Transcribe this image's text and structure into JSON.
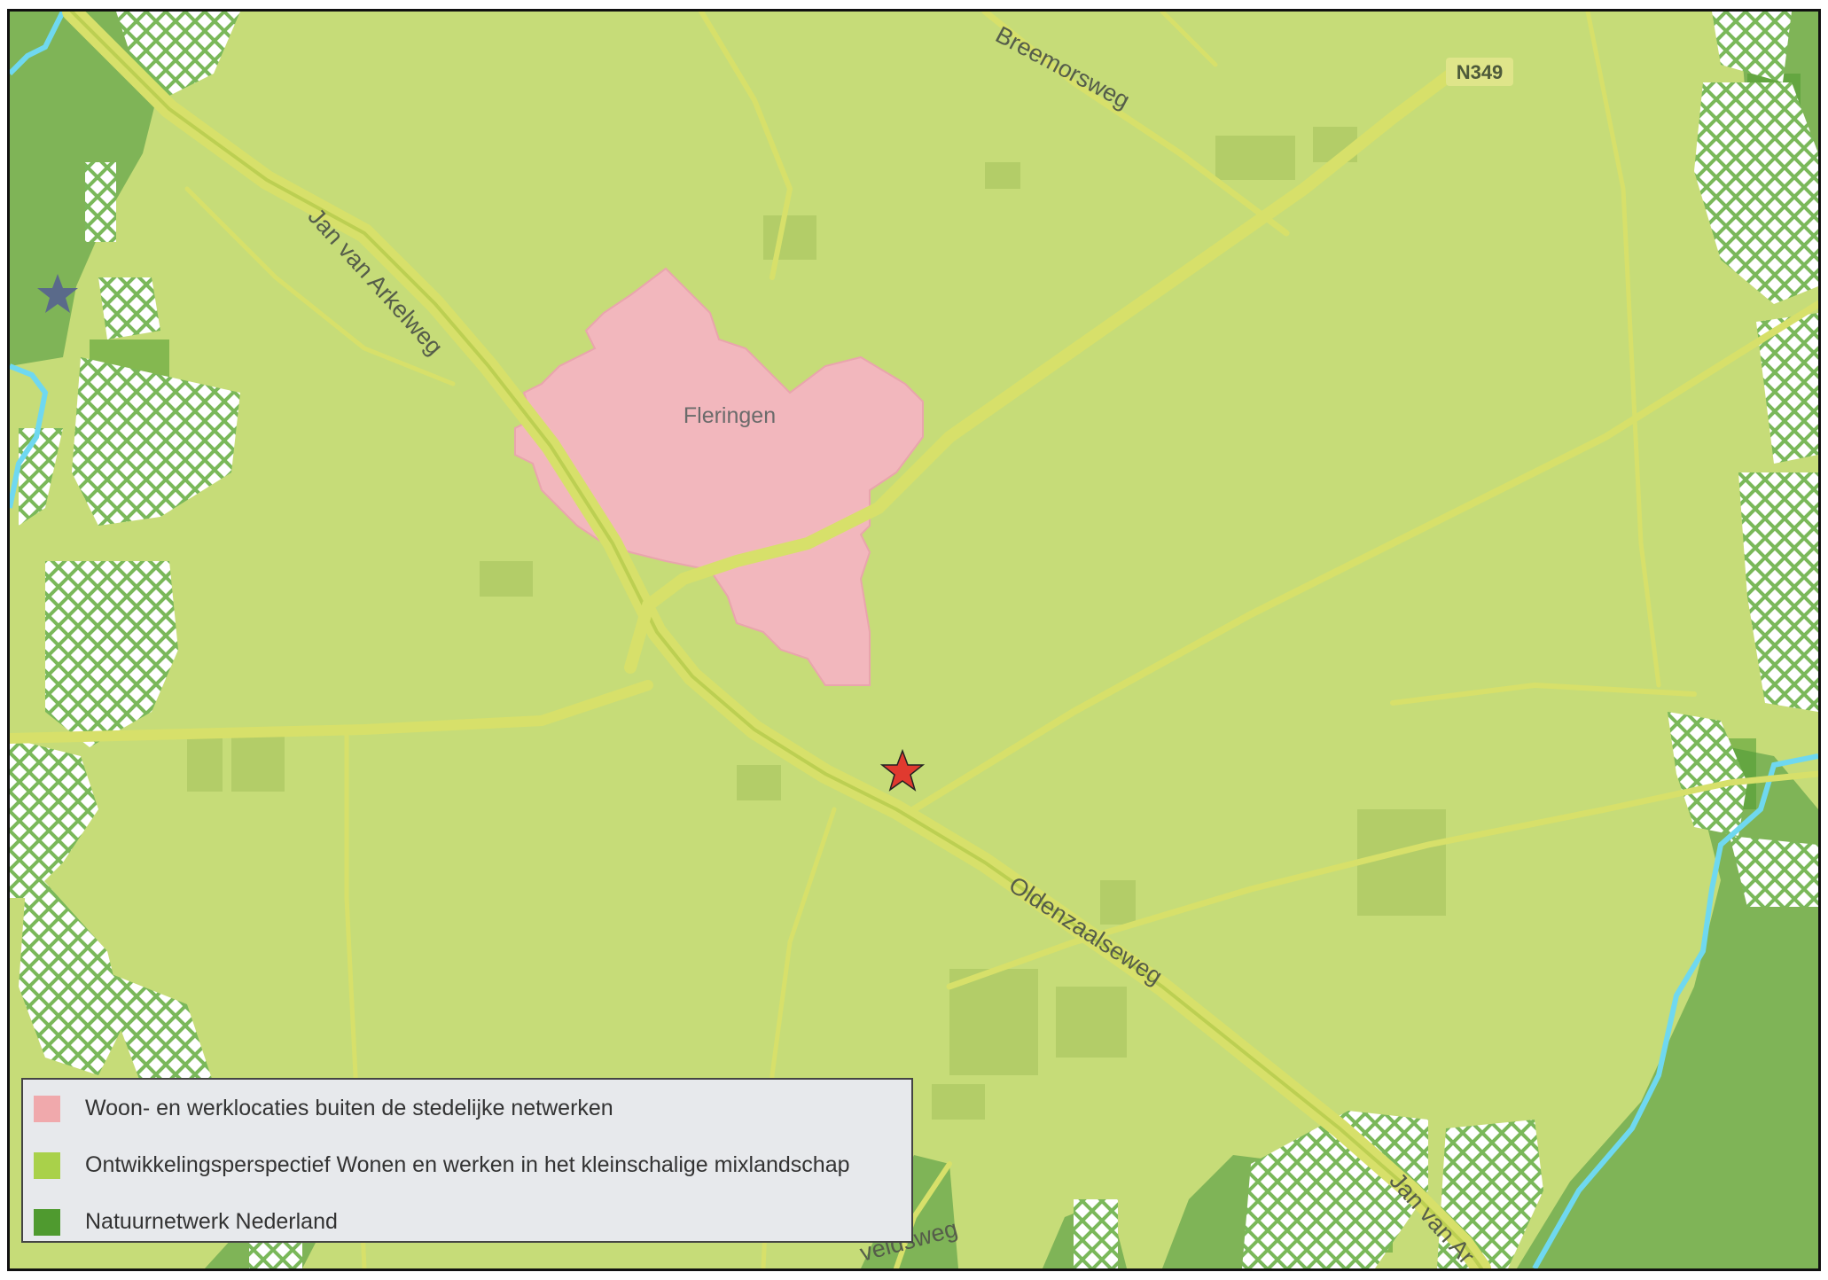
{
  "map": {
    "roads": {
      "jan_van_arkelweg_nw": "Jan van Arkelweg",
      "breemorsweg": "Breemorsweg",
      "oldenzaalseweg": "Oldenzaalseweg",
      "jan_van_arkelweg_se": "Jan van Ar",
      "veldsweg": "veldsweg"
    },
    "route_shield": "N349",
    "place_label": "Fleringen",
    "markers": [
      {
        "name": "site-marker",
        "icon": "star-icon",
        "color": "#e03a2f"
      },
      {
        "name": "poi-marker",
        "icon": "star-icon",
        "color": "#5a6a8a"
      }
    ],
    "colors": {
      "background": "#c6dc78",
      "nature": "#6fae48",
      "urban": "#f2b7bd",
      "water": "#6fd8f0",
      "roads": "#d7e06a"
    }
  },
  "legend": {
    "items": [
      {
        "label": "Woon- en werklocaties buiten de stedelijke netwerken",
        "color": "#f0a9ac"
      },
      {
        "label": "Ontwikkelingsperspectief Wonen en werken in het kleinschalige mixlandschap",
        "color": "#a9d14a"
      },
      {
        "label": "Natuurnetwerk Nederland",
        "color": "#4f9a2f"
      }
    ]
  }
}
